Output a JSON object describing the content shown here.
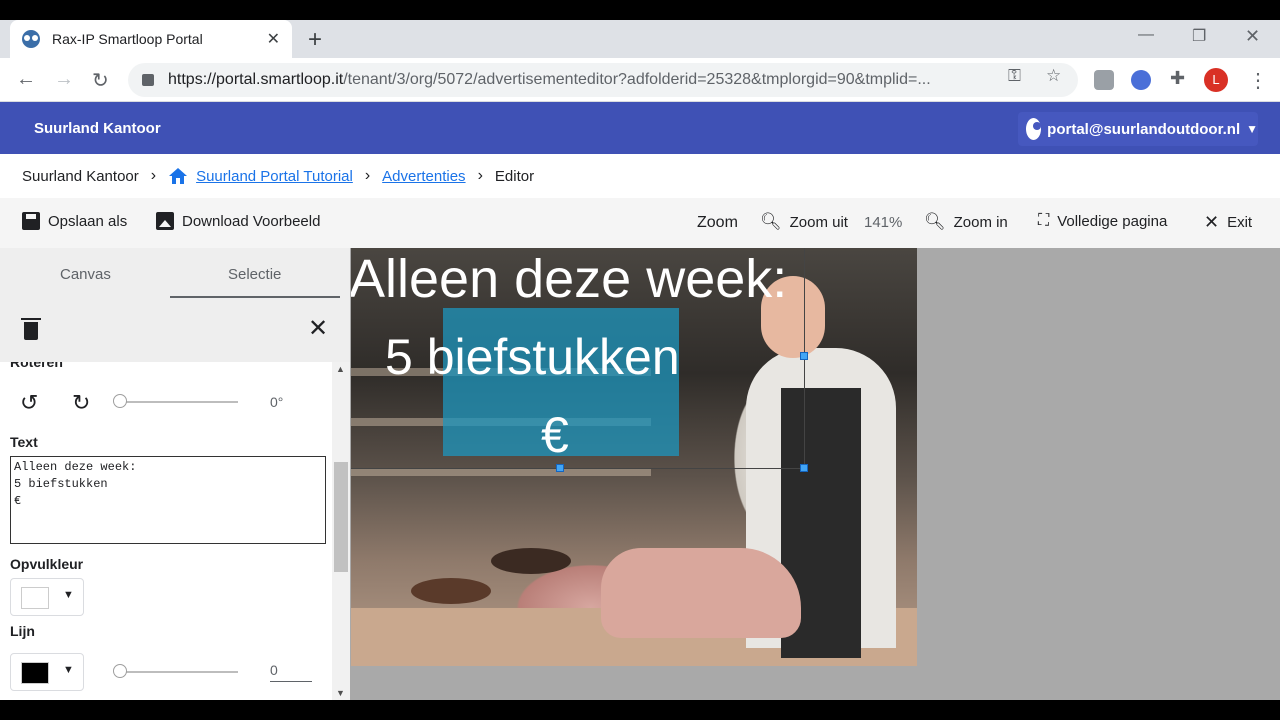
{
  "browser": {
    "tab_title": "Rax-IP Smartloop Portal",
    "url_main": "https://portal.smartloop.it",
    "url_rest": "/tenant/3/org/5072/advertisementeditor?adfolderid=25328&tmplorgid=90&tmplid=...",
    "profile_initial": "L"
  },
  "header": {
    "org_name": "Suurland Kantoor",
    "user_email": "portal@suurlandoutdoor.nl"
  },
  "breadcrumb": {
    "items": [
      "Suurland Kantoor",
      "Suurland Portal Tutorial",
      "Advertenties",
      "Editor"
    ]
  },
  "editor_toolbar": {
    "save_as": "Opslaan als",
    "download_preview": "Download Voorbeeld",
    "zoom_label": "Zoom",
    "zoom_out": "Zoom uit",
    "zoom_value": "141%",
    "zoom_in": "Zoom in",
    "full_page": "Volledige pagina",
    "exit": "Exit"
  },
  "panel": {
    "tabs": [
      "Canvas",
      "Selectie"
    ],
    "active_tab": "Selectie",
    "rotate_label": "Roteren",
    "rotate_value": "0°",
    "text_label": "Text",
    "text_value": "Alleen deze week:\n5 biefstukken\n€",
    "fill_label": "Opvulkleur",
    "fill_color": "#ffffff",
    "line_label": "Lijn",
    "line_color": "#000000",
    "line_width": "0"
  },
  "canvas": {
    "ad_line_1": "Alleen deze week:",
    "ad_line_2": "5 biefstukken",
    "ad_line_3": "€",
    "box_color": "#1e96be"
  },
  "colors": {
    "appbar": "#3f51b5",
    "link": "#1a73e8",
    "selection": "#1e88e5"
  }
}
